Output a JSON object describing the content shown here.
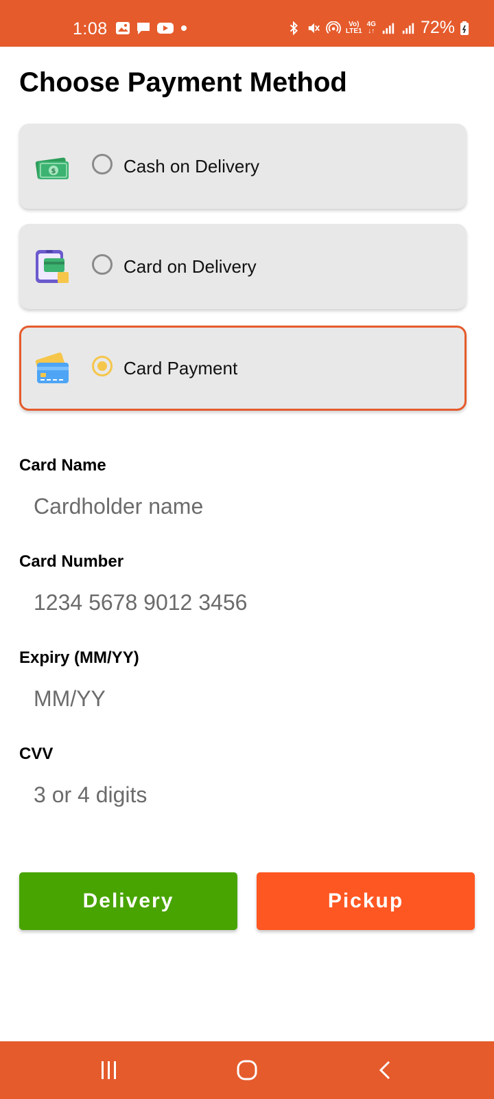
{
  "status_bar": {
    "time": "1:08",
    "battery": "72%",
    "signal_small_top": "Vo)",
    "signal_small_bottom": "LTE1",
    "network_type": "4G",
    "left_icons": [
      "gallery-icon",
      "message-icon",
      "youtube-icon",
      "dot-icon"
    ],
    "right_icons": [
      "bluetooth-icon",
      "mute-icon",
      "hotspot-icon",
      "volte-icon",
      "4g-icon",
      "signal-icon",
      "signal-icon",
      "battery-icon"
    ]
  },
  "page": {
    "title": "Choose Payment Method"
  },
  "payment_options": [
    {
      "label": "Cash on Delivery",
      "icon": "cash-icon",
      "selected": false
    },
    {
      "label": "Card on Delivery",
      "icon": "card-reader-icon",
      "selected": false
    },
    {
      "label": "Card Payment",
      "icon": "credit-card-icon",
      "selected": true
    }
  ],
  "form": {
    "card_name": {
      "label": "Card Name",
      "placeholder": "Cardholder name",
      "value": ""
    },
    "card_number": {
      "label": "Card Number",
      "placeholder": "1234 5678 9012 3456",
      "value": ""
    },
    "expiry": {
      "label": "Expiry (MM/YY)",
      "placeholder": "MM/YY",
      "value": ""
    },
    "cvv": {
      "label": "CVV",
      "placeholder": "3 or 4 digits",
      "value": ""
    }
  },
  "actions": {
    "delivery_label": "Delivery",
    "pickup_label": "Pickup"
  },
  "colors": {
    "accent": "#e55b2c",
    "delivery_button": "#48a401",
    "pickup_button": "#ff5722",
    "radio_selected": "#f5c64a",
    "card_background": "#e8e8e8"
  },
  "nav_bar": {
    "icons": [
      "recents-icon",
      "home-icon",
      "back-icon"
    ]
  }
}
